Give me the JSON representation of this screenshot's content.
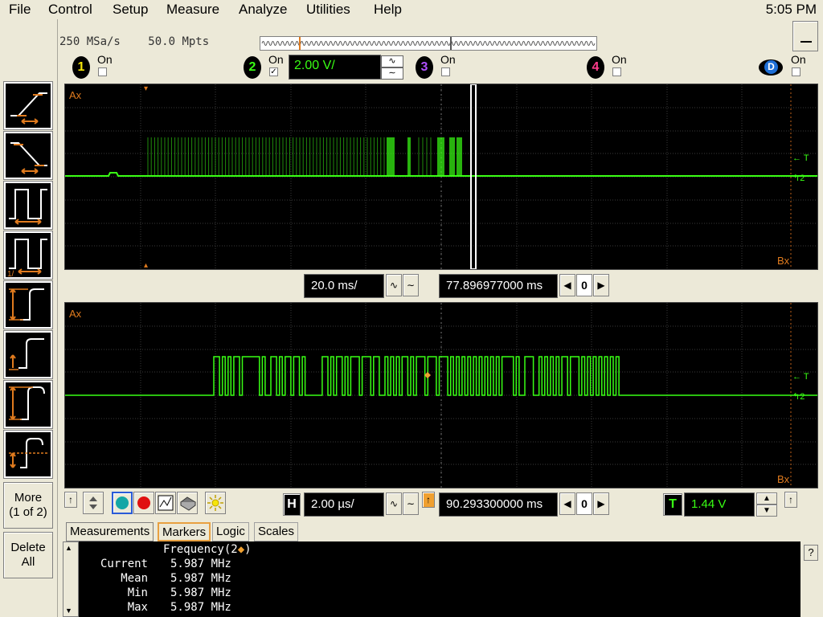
{
  "menu": {
    "items": [
      "File",
      "Control",
      "Setup",
      "Measure",
      "Analyze",
      "Utilities",
      "Help"
    ],
    "clock": "5:05 PM"
  },
  "acquisition": {
    "sample_rate": "250 MSa/s",
    "memory_depth": "50.0 Mpts"
  },
  "channels": {
    "ch1": {
      "number": "1",
      "on_label": "On",
      "checked": false,
      "color": "#f5e60a"
    },
    "ch2": {
      "number": "2",
      "on_label": "On",
      "checked": true,
      "color": "#39ff14",
      "scale": "2.00 V/",
      "coupling_top": "∿",
      "coupling_bottom": "∼"
    },
    "ch3": {
      "number": "3",
      "on_label": "On",
      "checked": false,
      "color": "#b050ff"
    },
    "ch4": {
      "number": "4",
      "on_label": "On",
      "checked": false,
      "color": "#ff3c8c"
    },
    "digital": {
      "label": "D",
      "on_label": "On",
      "checked": false
    }
  },
  "upper_display": {
    "marker_a": "Ax",
    "marker_b": "Bx",
    "trigger_tag": "T",
    "channel_tag": "2"
  },
  "main_timebase": {
    "scale": "20.0 ms/",
    "position": "77.896977000 ms",
    "nav_value": "0"
  },
  "lower_display": {
    "marker_a": "Ax",
    "marker_b": "Bx",
    "trigger_tag": "T",
    "channel_tag": "2"
  },
  "zoom_timebase": {
    "h_label": "H",
    "scale": "2.00 µs/",
    "position": "90.293300000 ms",
    "nav_value": "0"
  },
  "trigger": {
    "t_label": "T",
    "level": "1.44 V"
  },
  "left_softkeys": {
    "more_label_1": "More",
    "more_label_2": "(1 of 2)",
    "delete_label_1": "Delete",
    "delete_label_2": "All",
    "tool_icons": [
      "rise-time-icon",
      "fall-time-icon",
      "period-icon",
      "frequency-icon",
      "amplitude-icon",
      "top-level-icon",
      "peak-peak-icon",
      "average-icon"
    ]
  },
  "tabs": [
    "Measurements",
    "Markers",
    "Logic",
    "Scales"
  ],
  "measurements": {
    "header_name": "Frequency(2",
    "header_mark": "◆",
    "header_close": ")",
    "rows": [
      {
        "label": "Current",
        "value": "5.987 MHz"
      },
      {
        "label": "Mean",
        "value": "5.987 MHz"
      },
      {
        "label": "Min",
        "value": "5.987 MHz"
      },
      {
        "label": "Max",
        "value": "5.987 MHz"
      }
    ],
    "help": "?"
  },
  "colors": {
    "trace": "#39ff14",
    "marker": "#e07b1e",
    "grid": "#444444"
  }
}
